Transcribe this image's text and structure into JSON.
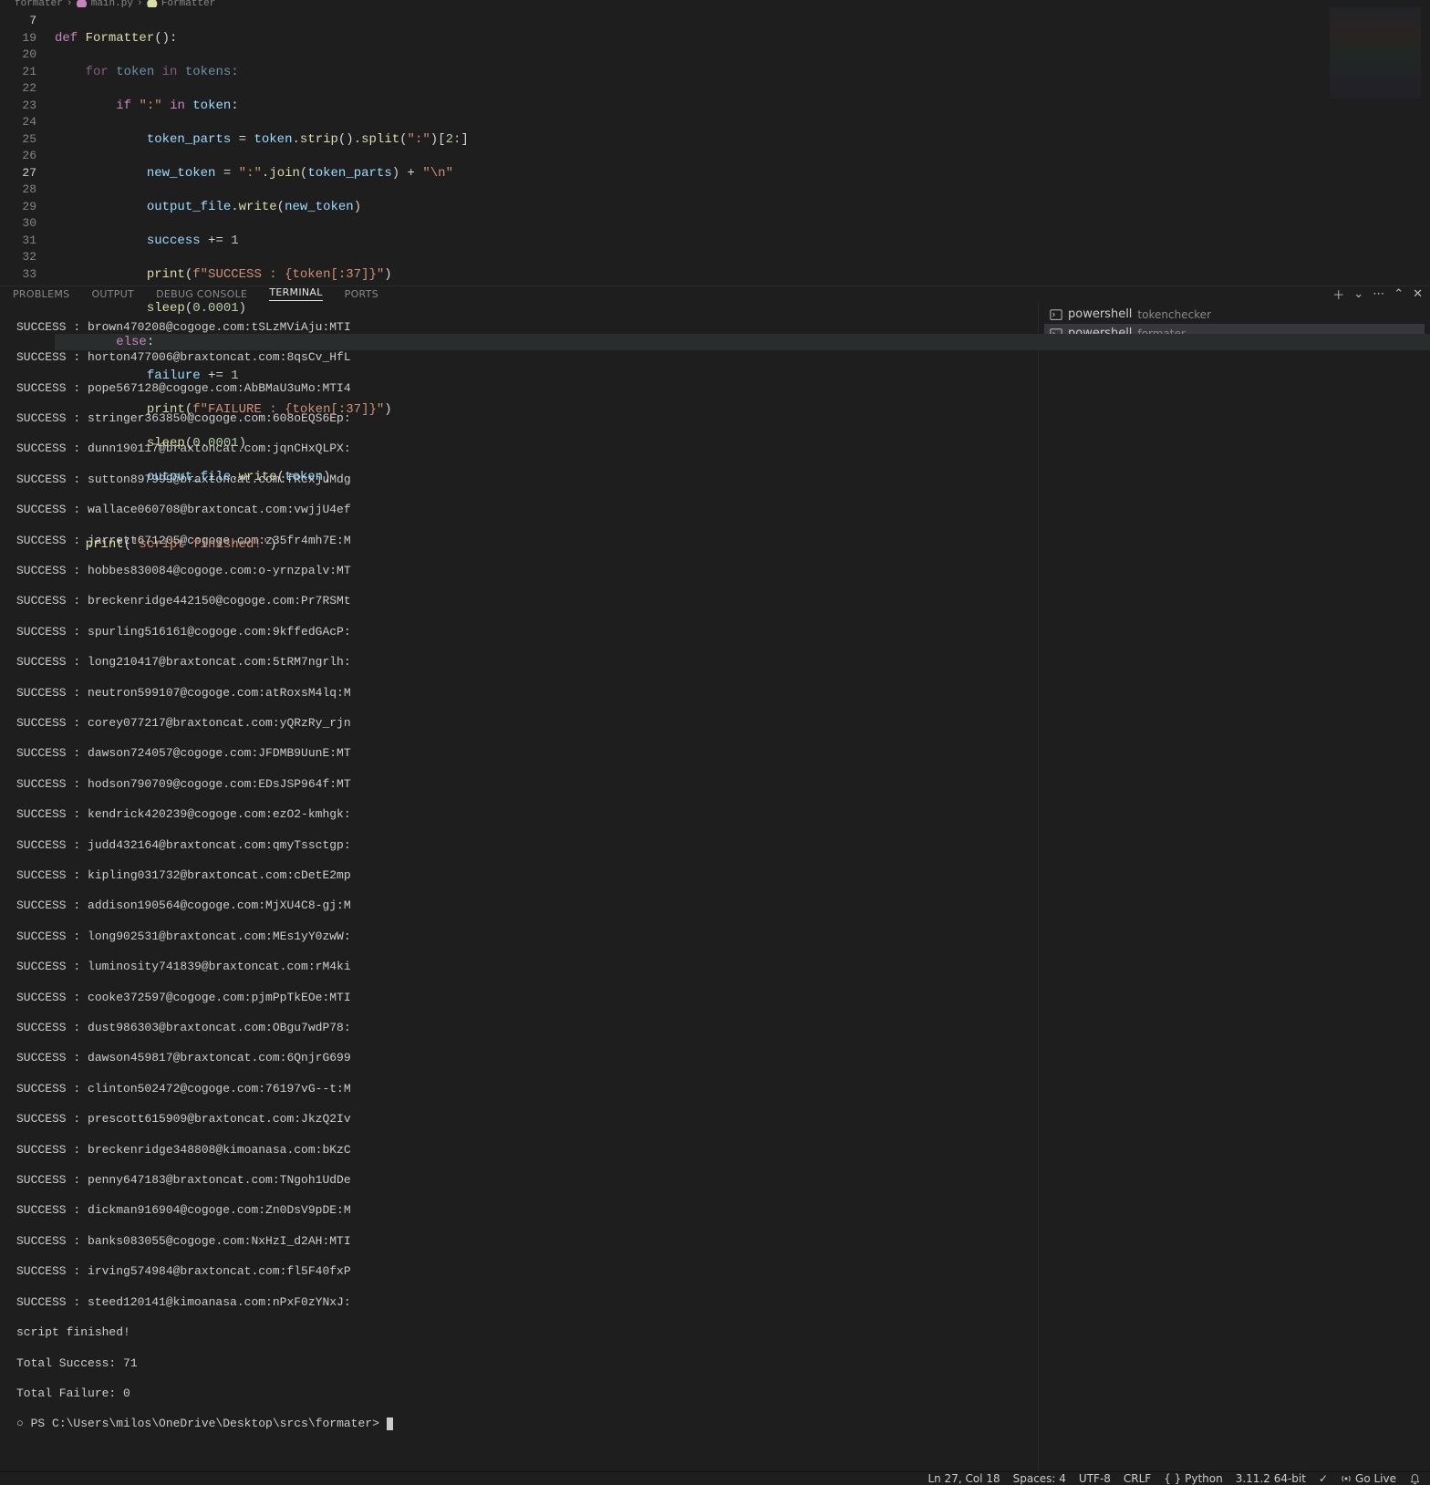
{
  "breadcrumb": {
    "parent": "formater",
    "file": "main.py",
    "symbol": "Formatter"
  },
  "editor": {
    "line_numbers": [
      "7",
      "19",
      "20",
      "21",
      "22",
      "23",
      "24",
      "25",
      "26",
      "27",
      "28",
      "29",
      "30",
      "31",
      "32",
      "33"
    ],
    "func_def": "def",
    "func_name": "Formatter",
    "for_kw": "for",
    "in_kw": "in",
    "tok": "token",
    "toks": "tokens",
    "if_kw": "if",
    "colon_str": "\":\"",
    "tparts": "token_parts",
    "strip": "strip",
    "split": "split",
    "slice": "2:",
    "new_tok": "new_token",
    "join": "join",
    "newline_str": "\"\\n\"",
    "outfile": "output_file",
    "write": "write",
    "success": "success",
    "one": "1",
    "print": "print",
    "fstr_succ": "f\"SUCCESS : {token[:37]}\"",
    "sleep": "sleep",
    "dur": "0.0001",
    "else_kw": "else",
    "failure": "failure",
    "fstr_fail": "f\"FAILURE : {token[:37]}\"",
    "done_str": "'script finished!'"
  },
  "panel": {
    "tabs": {
      "problems": "PROBLEMS",
      "output": "OUTPUT",
      "debug": "DEBUG CONSOLE",
      "terminal": "TERMINAL",
      "ports": "PORTS"
    }
  },
  "terminal": {
    "lines": [
      "SUCCESS : brown470208@cogoge.com:tSLzMViAju:MTI",
      "SUCCESS : horton477006@braxtoncat.com:8qsCv_HfL",
      "SUCCESS : pope567128@cogoge.com:AbBMaU3uMo:MTI4",
      "SUCCESS : stringer363850@cogoge.com:608oEQS6Ep:",
      "SUCCESS : dunn190117@braxtoncat.com:jqnCHxQLPX:",
      "SUCCESS : sutton897999@braxtoncat.com:fRcxjuMdg",
      "SUCCESS : wallace060708@braxtoncat.com:vwjjU4ef",
      "SUCCESS : jarrett671205@cogoge.com:z35fr4mh7E:M",
      "SUCCESS : hobbes830084@cogoge.com:o-yrnzpalv:MT",
      "SUCCESS : breckenridge442150@cogoge.com:Pr7RSMt",
      "SUCCESS : spurling516161@cogoge.com:9kffedGAcP:",
      "SUCCESS : long210417@braxtoncat.com:5tRM7ngrlh:",
      "SUCCESS : neutron599107@cogoge.com:atRoxsM4lq:M",
      "SUCCESS : corey077217@braxtoncat.com:yQRzRy_rjn",
      "SUCCESS : dawson724057@cogoge.com:JFDMB9UunE:MT",
      "SUCCESS : hodson790709@cogoge.com:EDsJSP964f:MT",
      "SUCCESS : kendrick420239@cogoge.com:ezO2-kmhgk:",
      "SUCCESS : judd432164@braxtoncat.com:qmyTssctgp:",
      "SUCCESS : kipling031732@braxtoncat.com:cDetE2mp",
      "SUCCESS : addison190564@cogoge.com:MjXU4C8-gj:M",
      "SUCCESS : long902531@braxtoncat.com:MEs1yY0zwW:",
      "SUCCESS : luminosity741839@braxtoncat.com:rM4ki",
      "SUCCESS : cooke372597@cogoge.com:pjmPpTkEOe:MTI",
      "SUCCESS : dust986303@braxtoncat.com:OBgu7wdP78:",
      "SUCCESS : dawson459817@braxtoncat.com:6QnjrG699",
      "SUCCESS : clinton502472@cogoge.com:76197vG--t:M",
      "SUCCESS : prescott615909@braxtoncat.com:JkzQ2Iv",
      "SUCCESS : breckenridge348808@kimoanasa.com:bKzC",
      "SUCCESS : penny647183@braxtoncat.com:TNgoh1UdDe",
      "SUCCESS : dickman916904@cogoge.com:Zn0DsV9pDE:M",
      "SUCCESS : banks083055@cogoge.com:NxHzI_d2AH:MTI",
      "SUCCESS : irving574984@braxtoncat.com:fl5F40fxP",
      "SUCCESS : steed120141@kimoanasa.com:nPxF0zYNxJ:",
      "script finished!",
      "Total Success: 71",
      "Total Failure: 0"
    ],
    "prompt_prefix": "○ ",
    "prompt": "PS C:\\Users\\milos\\OneDrive\\Desktop\\srcs\\formater> ",
    "side": {
      "shell1": "powershell",
      "label1": "tokenchecker",
      "shell2": "powershell",
      "label2": "formater"
    }
  },
  "statusbar": {
    "pos": "Ln 27, Col 18",
    "spaces": "Spaces: 4",
    "enc": "UTF-8",
    "eol": "CRLF",
    "lang": "{ } Python",
    "ver": "3.11.2 64-bit",
    "golive": "Go Live"
  }
}
